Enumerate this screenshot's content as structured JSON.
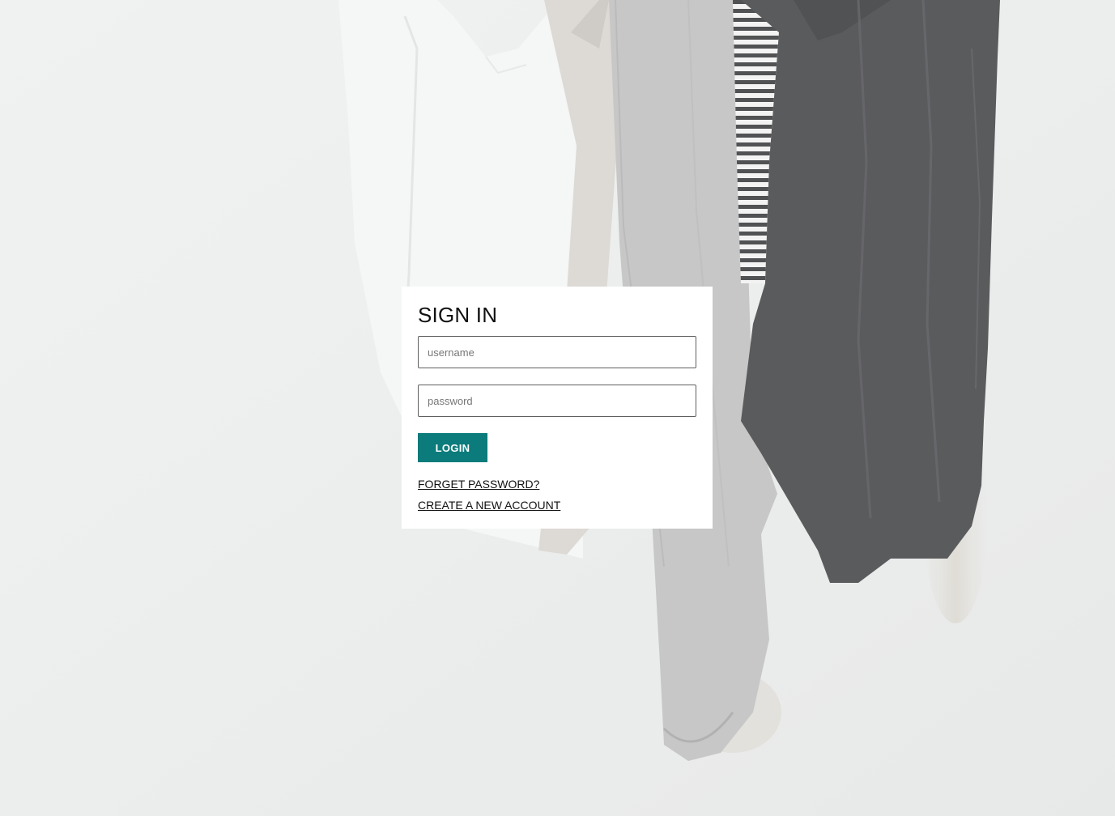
{
  "login_form": {
    "title": "SIGN IN",
    "username_placeholder": "username",
    "password_placeholder": "password",
    "login_label": "LOGIN",
    "forgot_password_label": "FORGET PASSWORD?",
    "create_account_label": "CREATE A NEW ACCOUNT"
  },
  "colors": {
    "accent": "#0b7b7b",
    "card_background": "#ffffff",
    "page_background": "#eceeee"
  },
  "background": {
    "icon": "hanging-clothes-photo"
  }
}
